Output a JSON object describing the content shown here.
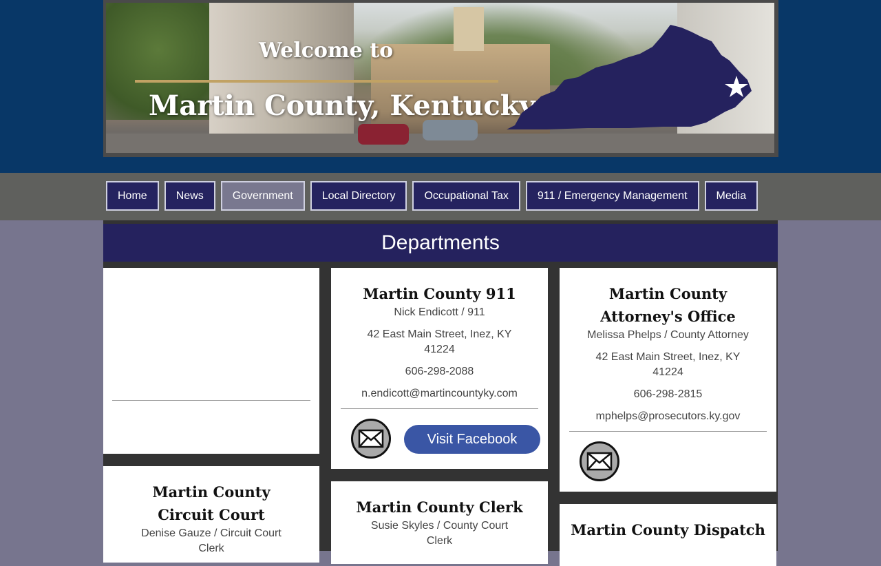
{
  "banner": {
    "welcome": "Welcome to",
    "title": "Martin County, Kentucky",
    "map_icon": "kentucky-map-with-star",
    "colors": {
      "band": "#083767",
      "gold_rule": "#c1a264",
      "map": "#25225e"
    }
  },
  "nav": {
    "items": [
      {
        "label": "Home",
        "active": false
      },
      {
        "label": "News",
        "active": false
      },
      {
        "label": "Government",
        "active": true
      },
      {
        "label": "Local Directory",
        "active": false
      },
      {
        "label": "Occupational Tax",
        "active": false
      },
      {
        "label": "911 / Emergency Management",
        "active": false
      },
      {
        "label": "Media",
        "active": false
      }
    ],
    "colors": {
      "item_bg": "#25235f",
      "active_bg": "#79788f"
    }
  },
  "page": {
    "heading": "Departments"
  },
  "departments": [
    {
      "name": "Martin County 911",
      "contact": "Nick Endicott / 911",
      "address": "42 East Main Street, Inez, KY 41224",
      "phone": "606-298-2088",
      "email": "n.endicott@martincountyky.com",
      "facebook_label": "Visit Facebook",
      "mail_icon": "envelope-icon"
    },
    {
      "name": "Martin County Attorney's Office",
      "contact": "Melissa Phelps / County Attorney",
      "address": "42 East Main Street, Inez, KY 41224",
      "phone": "606-298-2815",
      "email": "mphelps@prosecutors.ky.gov",
      "mail_icon": "envelope-icon"
    },
    {
      "name": "Martin County Circuit Court",
      "contact": "Denise Gauze / Circuit Court Clerk"
    },
    {
      "name": "Martin County Clerk",
      "contact": "Susie Skyles / County Court Clerk"
    },
    {
      "name": "Martin County Dispatch"
    }
  ]
}
